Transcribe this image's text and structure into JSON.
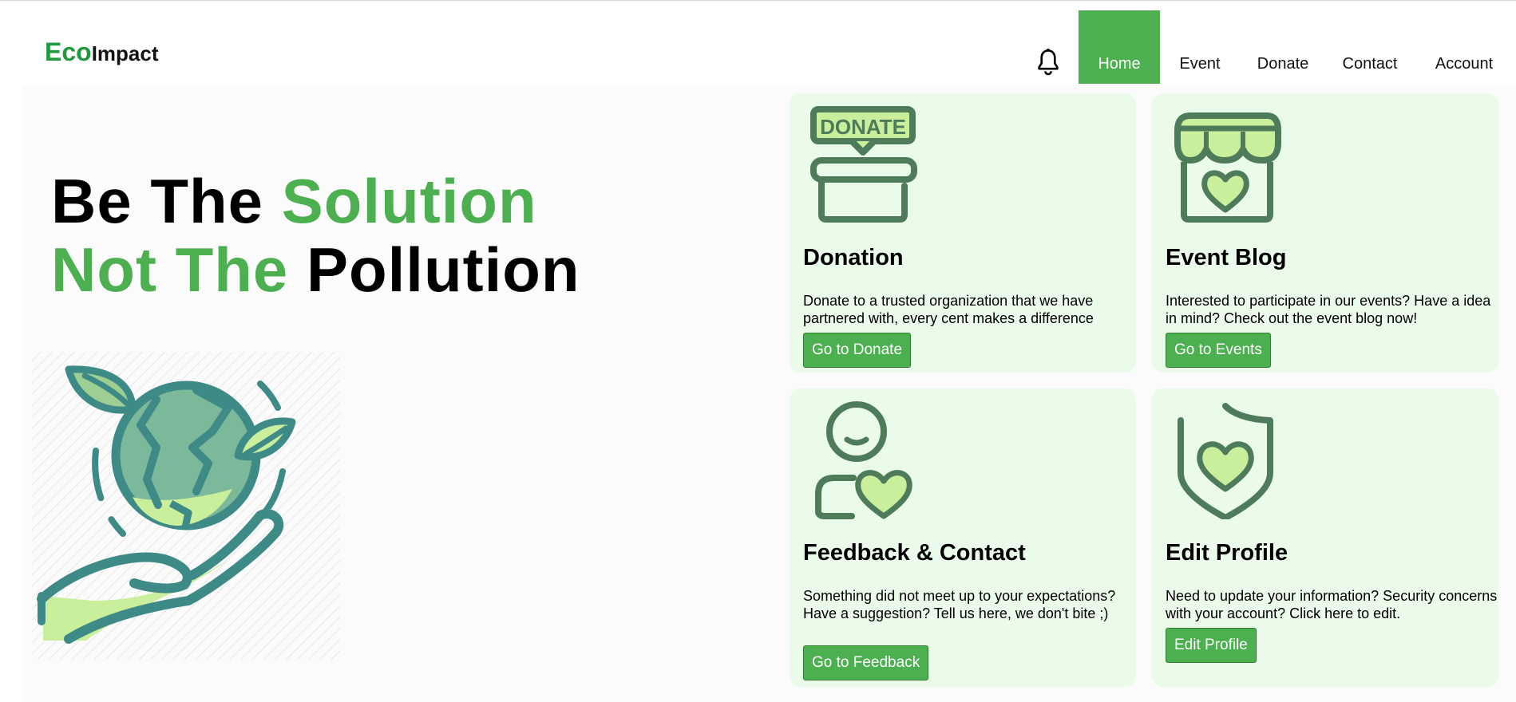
{
  "logo": {
    "eco": "Eco",
    "impact": "Impact"
  },
  "nav": {
    "notifications_icon": "bell-icon",
    "items": [
      {
        "label": "Home",
        "active": true
      },
      {
        "label": "Event",
        "active": false
      },
      {
        "label": "Donate",
        "active": false
      },
      {
        "label": "Contact",
        "active": false
      },
      {
        "label": "Account",
        "active": false
      }
    ]
  },
  "hero": {
    "line1_a": "Be The ",
    "line1_b": "Solution",
    "line2_a": "Not The ",
    "line2_b": "Pollution",
    "illustration": "earth-in-hand-icon"
  },
  "cards": [
    {
      "icon": "donate-box-icon",
      "title": "Donation",
      "text": "Donate to a trusted organization that we have partnered with, every cent makes a difference",
      "button": "Go to Donate"
    },
    {
      "icon": "store-heart-icon",
      "title": "Event Blog",
      "text": "Interested to participate in our events? Have a idea in mind? Check out the event blog now!",
      "button": "Go to Events"
    },
    {
      "icon": "person-heart-icon",
      "title": "Feedback & Contact",
      "text": "Something did not meet up to your expectations? Have a suggestion? Tell us here, we don't bite ;)",
      "button": "Go to Feedback"
    },
    {
      "icon": "shield-heart-icon",
      "title": "Edit Profile",
      "text": "Need to update your information? Security concerns with your account? Click here to edit.",
      "button": "Edit Profile"
    }
  ],
  "colors": {
    "accent": "#4caf50",
    "logo_green": "#1f9a3e",
    "card_bg": "#eafbea",
    "icon_dark": "#4e7c5a",
    "icon_light": "#c9ef9c",
    "earth_teal": "#3e8a86"
  }
}
